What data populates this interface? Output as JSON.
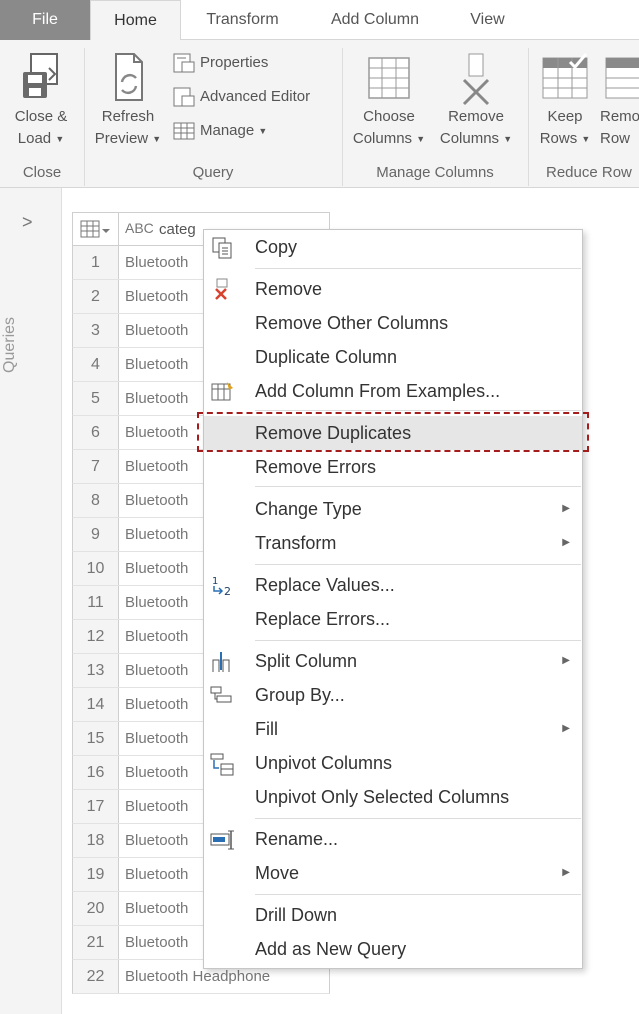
{
  "tabs": {
    "file": "File",
    "home": "Home",
    "transform": "Transform",
    "add_column": "Add Column",
    "view": "View"
  },
  "ribbon": {
    "close_group": {
      "btn_line1": "Close &",
      "btn_line2": "Load",
      "label": "Close"
    },
    "query_group": {
      "refresh_line1": "Refresh",
      "refresh_line2": "Preview",
      "properties": "Properties",
      "advanced_editor": "Advanced Editor",
      "manage": "Manage",
      "label": "Query"
    },
    "manage_columns_group": {
      "choose_line1": "Choose",
      "choose_line2": "Columns",
      "remove_line1": "Remove",
      "remove_line2": "Columns",
      "label": "Manage Columns"
    },
    "reduce_rows_group": {
      "keep_line1": "Keep",
      "keep_line2": "Rows",
      "remove_line1": "Remo",
      "remove_line2": "Row",
      "label": "Reduce Row"
    }
  },
  "queries_pane": {
    "label": "Queries"
  },
  "grid": {
    "column_type": "ABC",
    "column_name": "categ",
    "rows": [
      {
        "n": "1",
        "v": "Bluetooth"
      },
      {
        "n": "2",
        "v": "Bluetooth"
      },
      {
        "n": "3",
        "v": "Bluetooth"
      },
      {
        "n": "4",
        "v": "Bluetooth"
      },
      {
        "n": "5",
        "v": "Bluetooth"
      },
      {
        "n": "6",
        "v": "Bluetooth"
      },
      {
        "n": "7",
        "v": "Bluetooth"
      },
      {
        "n": "8",
        "v": "Bluetooth"
      },
      {
        "n": "9",
        "v": "Bluetooth"
      },
      {
        "n": "10",
        "v": "Bluetooth"
      },
      {
        "n": "11",
        "v": "Bluetooth"
      },
      {
        "n": "12",
        "v": "Bluetooth"
      },
      {
        "n": "13",
        "v": "Bluetooth"
      },
      {
        "n": "14",
        "v": "Bluetooth"
      },
      {
        "n": "15",
        "v": "Bluetooth"
      },
      {
        "n": "16",
        "v": "Bluetooth"
      },
      {
        "n": "17",
        "v": "Bluetooth"
      },
      {
        "n": "18",
        "v": "Bluetooth"
      },
      {
        "n": "19",
        "v": "Bluetooth"
      },
      {
        "n": "20",
        "v": "Bluetooth"
      },
      {
        "n": "21",
        "v": "Bluetooth"
      },
      {
        "n": "22",
        "v": "Bluetooth Headphone"
      }
    ]
  },
  "context_menu": {
    "items": [
      {
        "label": "Copy",
        "icon": "copy-icon",
        "submenu": false
      },
      {
        "label": "Remove",
        "icon": "remove-column-icon",
        "submenu": false
      },
      {
        "label": "Remove Other Columns",
        "icon": "",
        "submenu": false
      },
      {
        "label": "Duplicate Column",
        "icon": "",
        "submenu": false
      },
      {
        "label": "Add Column From Examples...",
        "icon": "add-column-examples-icon",
        "submenu": false
      },
      {
        "label": "Remove Duplicates",
        "icon": "",
        "submenu": false,
        "highlighted": true
      },
      {
        "label": "Remove Errors",
        "icon": "",
        "submenu": false
      },
      {
        "label": "Change Type",
        "icon": "",
        "submenu": true
      },
      {
        "label": "Transform",
        "icon": "",
        "submenu": true
      },
      {
        "label": "Replace Values...",
        "icon": "replace-values-icon",
        "submenu": false
      },
      {
        "label": "Replace Errors...",
        "icon": "",
        "submenu": false
      },
      {
        "label": "Split Column",
        "icon": "split-column-icon",
        "submenu": true
      },
      {
        "label": "Group By...",
        "icon": "group-by-icon",
        "submenu": false
      },
      {
        "label": "Fill",
        "icon": "",
        "submenu": true
      },
      {
        "label": "Unpivot Columns",
        "icon": "unpivot-icon",
        "submenu": false
      },
      {
        "label": "Unpivot Only Selected Columns",
        "icon": "",
        "submenu": false
      },
      {
        "label": "Rename...",
        "icon": "rename-icon",
        "submenu": false
      },
      {
        "label": "Move",
        "icon": "",
        "submenu": true
      },
      {
        "label": "Drill Down",
        "icon": "",
        "submenu": false
      },
      {
        "label": "Add as New Query",
        "icon": "",
        "submenu": false
      }
    ],
    "highlight_outline_color": "#a51c1c"
  }
}
